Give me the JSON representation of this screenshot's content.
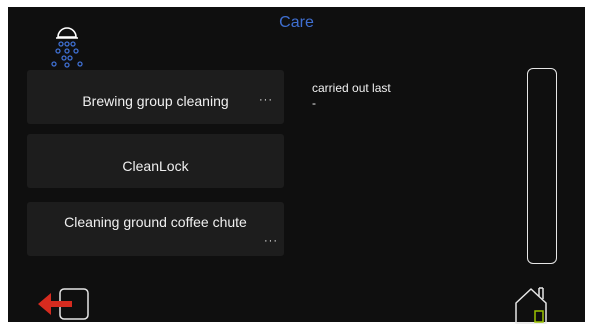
{
  "header": {
    "title": "Care",
    "title_color": "#3f6fd1",
    "icon": "care-shower-icon"
  },
  "menu": {
    "items": [
      {
        "label": "Brewing group cleaning",
        "more": "···"
      },
      {
        "label": "CleanLock"
      },
      {
        "label": "Cleaning ground coffee chute",
        "more": "···"
      }
    ]
  },
  "info": {
    "label": "carried out last",
    "value": "-"
  },
  "footer": {
    "exit_icon": "exit-icon",
    "home_icon": "home-icon"
  },
  "colors": {
    "background": "#0f0f0f",
    "button": "#1d1d1d",
    "accent_blue": "#3f6fd1",
    "exit_red": "#d62b1f",
    "home_accent": "#9bc400"
  }
}
